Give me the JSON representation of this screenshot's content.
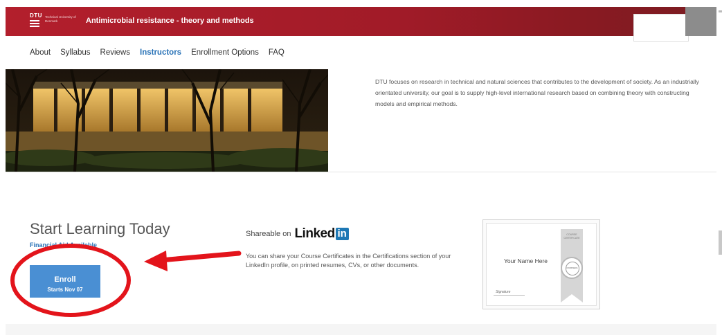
{
  "header": {
    "logo_mark": "DTU",
    "logo_text": "Technical University of Denmark",
    "course_title": "Antimicrobial resistance - theory and methods"
  },
  "nav": {
    "items": [
      "About",
      "Syllabus",
      "Reviews",
      "Instructors",
      "Enrollment Options",
      "FAQ"
    ],
    "active": "Instructors"
  },
  "about": {
    "text": "DTU focuses on research in technical and natural sciences that contributes to the development of society. As an industrially orientated university, our goal is to supply high-level international research based on combining theory with constructing models and empirical methods."
  },
  "enroll_section": {
    "title": "Start Learning Today",
    "financial_aid": "Financial Aid Available",
    "button_label": "Enroll",
    "button_sub": "Starts Nov 07"
  },
  "shareable": {
    "prefix": "Shareable on",
    "brand_word": "Linked",
    "brand_box": "in",
    "text": "You can share your Course Certificates in the Certifications section of your LinkedIn profile, on printed resumes, CVs, or other documents."
  },
  "certificate": {
    "ribbon_label": "COURSE CERTIFICATE",
    "name_placeholder": "Your Name Here",
    "seal_text": "COURSERA",
    "signature": "Signature"
  },
  "colors": {
    "header_red": "#b31f2c",
    "link_blue": "#2a73b7",
    "button_blue": "#4a8fd3",
    "annotation_red": "#e3141b"
  },
  "icons": {
    "annotation_arrow": "arrow-left-icon",
    "annotation_circle": "circle-highlight"
  }
}
